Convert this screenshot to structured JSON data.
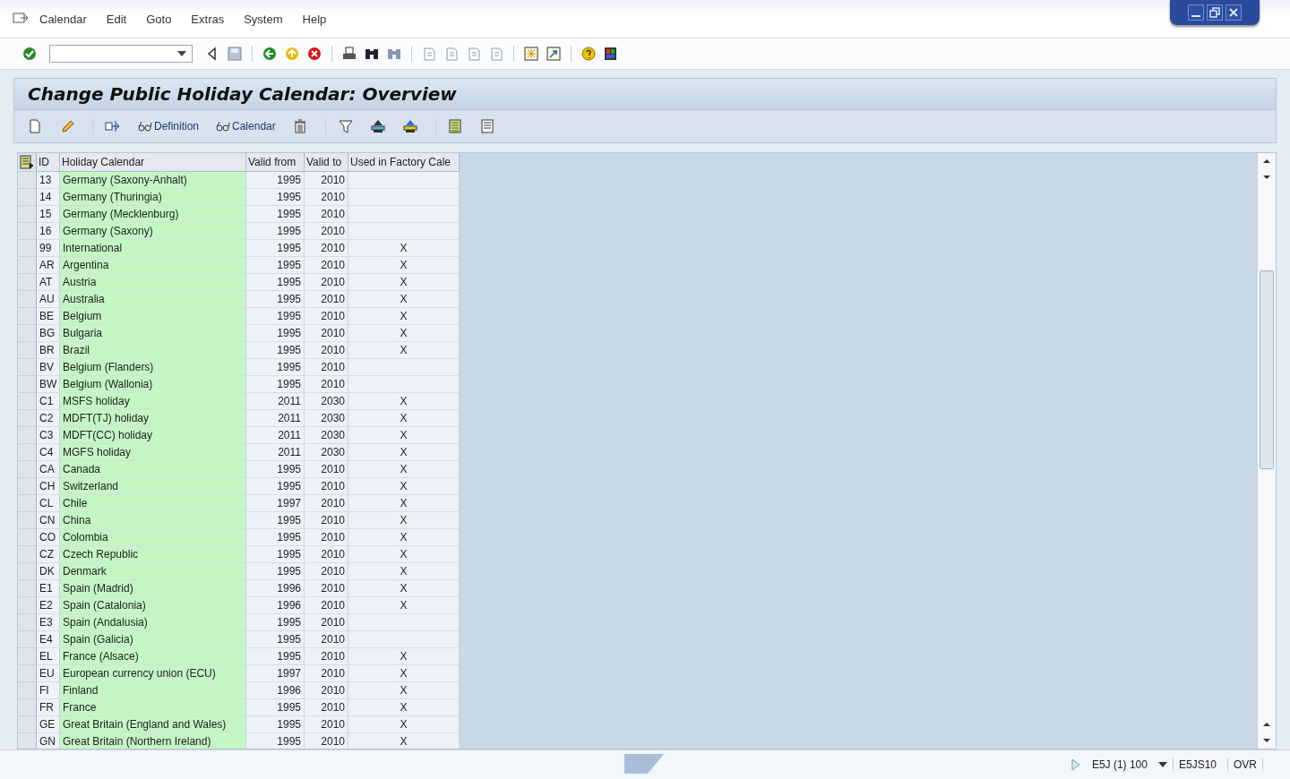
{
  "menu": [
    "Calendar",
    "Edit",
    "Goto",
    "Extras",
    "System",
    "Help"
  ],
  "title": "Change Public Holiday Calendar: Overview",
  "app_toolbar": [
    {
      "kind": "icon"
    },
    {
      "kind": "icon"
    },
    {
      "kind": "sep"
    },
    {
      "kind": "icon"
    },
    {
      "kind": "text",
      "label": "Definition"
    },
    {
      "kind": "text",
      "label": "Calendar"
    },
    {
      "kind": "icon"
    },
    {
      "kind": "sep"
    },
    {
      "kind": "icon"
    },
    {
      "kind": "icon"
    },
    {
      "kind": "icon"
    },
    {
      "kind": "sep"
    },
    {
      "kind": "icon"
    },
    {
      "kind": "icon"
    }
  ],
  "table": {
    "columns": [
      "ID",
      "Holiday Calendar",
      "Valid from",
      "Valid to",
      "Used in Factory Cale"
    ],
    "rows": [
      {
        "id": "13",
        "name": "Germany (Saxony-Anhalt)",
        "from": "1995",
        "to": "2010"
      },
      {
        "id": "14",
        "name": "Germany (Thuringia)",
        "from": "1995",
        "to": "2010"
      },
      {
        "id": "15",
        "name": "Germany (Mecklenburg)",
        "from": "1995",
        "to": "2010"
      },
      {
        "id": "16",
        "name": "Germany (Saxony)",
        "from": "1995",
        "to": "2010"
      },
      {
        "id": "99",
        "name": "International",
        "from": "1995",
        "to": "2010",
        "used": "X"
      },
      {
        "id": "AR",
        "name": "Argentina",
        "from": "1995",
        "to": "2010",
        "used": "X"
      },
      {
        "id": "AT",
        "name": "Austria",
        "from": "1995",
        "to": "2010",
        "used": "X"
      },
      {
        "id": "AU",
        "name": "Australia",
        "from": "1995",
        "to": "2010",
        "used": "X"
      },
      {
        "id": "BE",
        "name": "Belgium",
        "from": "1995",
        "to": "2010",
        "used": "X"
      },
      {
        "id": "BG",
        "name": "Bulgaria",
        "from": "1995",
        "to": "2010",
        "used": "X"
      },
      {
        "id": "BR",
        "name": "Brazil",
        "from": "1995",
        "to": "2010",
        "used": "X"
      },
      {
        "id": "BV",
        "name": "Belgium (Flanders)",
        "from": "1995",
        "to": "2010"
      },
      {
        "id": "BW",
        "name": "Belgium (Wallonia)",
        "from": "1995",
        "to": "2010"
      },
      {
        "id": "C1",
        "name": "MSFS holiday",
        "from": "2011",
        "to": "2030",
        "used": "X"
      },
      {
        "id": "C2",
        "name": "MDFT(TJ) holiday",
        "from": "2011",
        "to": "2030",
        "used": "X"
      },
      {
        "id": "C3",
        "name": "MDFT(CC) holiday",
        "from": "2011",
        "to": "2030",
        "used": "X"
      },
      {
        "id": "C4",
        "name": "MGFS holiday",
        "from": "2011",
        "to": "2030",
        "used": "X"
      },
      {
        "id": "CA",
        "name": "Canada",
        "from": "1995",
        "to": "2010",
        "used": "X"
      },
      {
        "id": "CH",
        "name": "Switzerland",
        "from": "1995",
        "to": "2010",
        "used": "X"
      },
      {
        "id": "CL",
        "name": "Chile",
        "from": "1997",
        "to": "2010",
        "used": "X"
      },
      {
        "id": "CN",
        "name": "China",
        "from": "1995",
        "to": "2010",
        "used": "X"
      },
      {
        "id": "CO",
        "name": "Colombia",
        "from": "1995",
        "to": "2010",
        "used": "X"
      },
      {
        "id": "CZ",
        "name": "Czech Republic",
        "from": "1995",
        "to": "2010",
        "used": "X"
      },
      {
        "id": "DK",
        "name": "Denmark",
        "from": "1995",
        "to": "2010",
        "used": "X"
      },
      {
        "id": "E1",
        "name": "Spain (Madrid)",
        "from": "1996",
        "to": "2010",
        "used": "X"
      },
      {
        "id": "E2",
        "name": "Spain (Catalonia)",
        "from": "1996",
        "to": "2010",
        "used": "X"
      },
      {
        "id": "E3",
        "name": "Spain (Andalusia)",
        "from": "1995",
        "to": "2010"
      },
      {
        "id": "E4",
        "name": "Spain (Galicia)",
        "from": "1995",
        "to": "2010"
      },
      {
        "id": "EL",
        "name": "France (Alsace)",
        "from": "1995",
        "to": "2010",
        "used": "X"
      },
      {
        "id": "EU",
        "name": "European currency union (ECU)",
        "from": "1997",
        "to": "2010",
        "used": "X"
      },
      {
        "id": "FI",
        "name": "Finland",
        "from": "1996",
        "to": "2010",
        "used": "X"
      },
      {
        "id": "FR",
        "name": "France",
        "from": "1995",
        "to": "2010",
        "used": "X"
      },
      {
        "id": "GE",
        "name": "Great Britain (England and Wales)",
        "from": "1995",
        "to": "2010",
        "used": "X"
      },
      {
        "id": "GN",
        "name": "Great Britain (Northern Ireland)",
        "from": "1995",
        "to": "2010",
        "used": "X"
      }
    ]
  },
  "status_bar": {
    "system": "E5J (1) 100",
    "server": "E5JS10",
    "mode": "OVR"
  }
}
